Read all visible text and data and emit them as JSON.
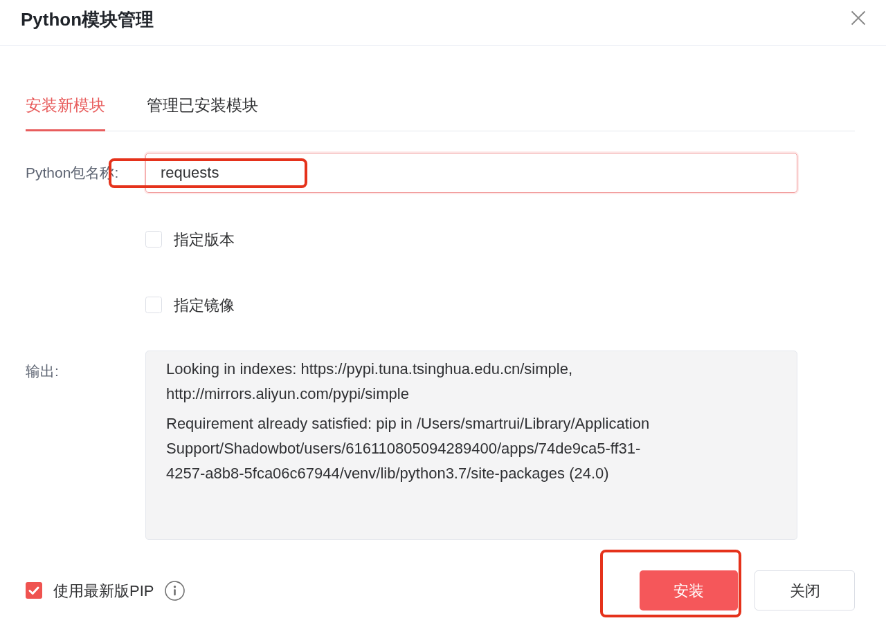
{
  "window": {
    "title": "Python模块管理"
  },
  "tabs": [
    {
      "label": "安装新模块",
      "selected": true
    },
    {
      "label": "管理已安装模块",
      "selected": false
    }
  ],
  "package_field": {
    "label": "Python包名称:",
    "value": "requests",
    "focused": true,
    "highlighted": true
  },
  "options": [
    {
      "label": "指定版本",
      "checked": false
    },
    {
      "label": "指定镜像",
      "checked": false
    }
  ],
  "output": {
    "label": "输出:",
    "paragraphs": [
      [
        "Looking in indexes: https://pypi.tuna.tsinghua.edu.cn/simple,",
        "http://mirrors.aliyun.com/pypi/simple"
      ],
      [
        "Requirement already satisfied: pip in /Users/smartrui/Library/Application",
        "Support/Shadowbot/users/616110805094289400/apps/74de9ca5-ff31-",
        "4257-a8b8-5fca06c67944/venv/lib/python3.7/site-packages (24.0)"
      ]
    ]
  },
  "use_latest_pip": {
    "label": "使用最新版PIP",
    "checked": true
  },
  "buttons": [
    {
      "label": "安装",
      "kind": "primary",
      "highlighted": true
    },
    {
      "label": "关闭",
      "kind": "default",
      "highlighted": false
    }
  ]
}
